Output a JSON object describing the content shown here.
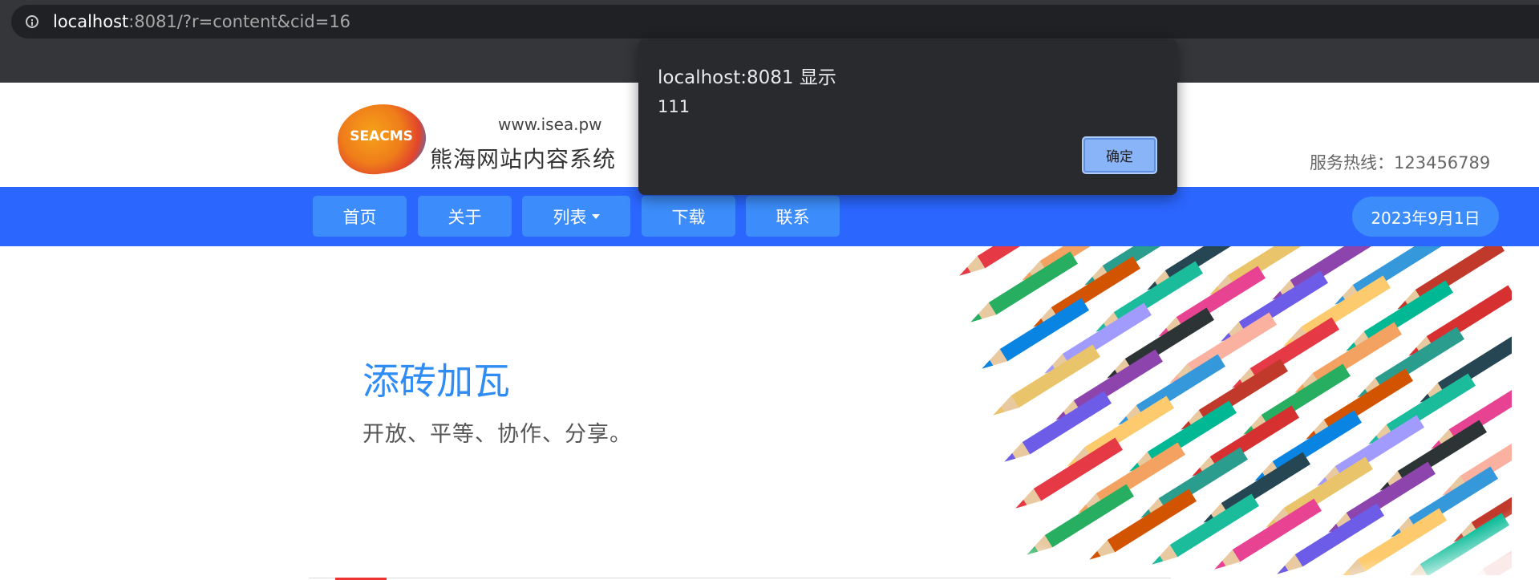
{
  "browser": {
    "url_host": "localhost",
    "url_rest": ":8081/?r=content&cid=16"
  },
  "header": {
    "logo_badge": "SEACMS",
    "logo_url": "www.isea.pw",
    "logo_name": "熊海网站内容系统",
    "hotline": "服务热线：123456789"
  },
  "nav": {
    "items": [
      {
        "label": "首页"
      },
      {
        "label": "关于"
      },
      {
        "label": "列表",
        "has_dropdown": true
      },
      {
        "label": "下载"
      },
      {
        "label": "联系"
      }
    ],
    "date": "2023年9月1日"
  },
  "banner": {
    "title": "添砖加瓦",
    "subtitle": "开放、平等、协作、分享。"
  },
  "alert": {
    "title": "localhost:8081 显示",
    "message": "111",
    "ok_label": "确定"
  },
  "colors": {
    "nav_bg": "#2b66ff",
    "nav_button": "#3c8dfb",
    "banner_title": "#2f8cf5",
    "dialog_bg": "#292a2d",
    "dialog_button": "#8ab4f8"
  }
}
